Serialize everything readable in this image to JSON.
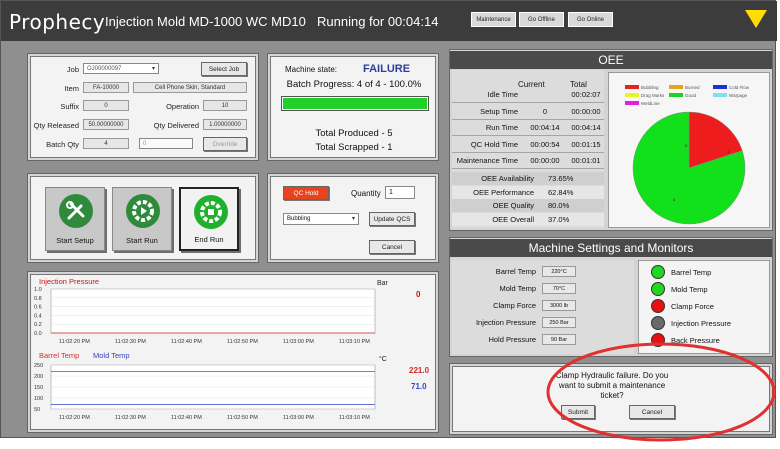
{
  "header": {
    "brand": "Prophecy",
    "machine_title": "Injection Mold MD-1000 WC MD10",
    "running": "Running for 00:04:14",
    "buttons": [
      "Maintenance",
      "Go Offline",
      "Go Online"
    ],
    "warning_icon": "warning-triangle-icon",
    "warning_color": "#ffdd00"
  },
  "job": {
    "job_label": "Job",
    "job_value": "OJ00000097",
    "select_job": "Select Job",
    "item_label": "Item",
    "item_value": "FA-10000",
    "item_desc": "Cell Phone Skin, Standard",
    "suffix_label": "Suffix",
    "suffix_value": "0",
    "operation_label": "Operation",
    "operation_value": "10",
    "qty_released_label": "Qty Released",
    "qty_released_value": "50.00000000",
    "qty_delivered_label": "Qty Delivered",
    "qty_delivered_value": "1.00000000",
    "batch_qty_label": "Batch Qty",
    "batch_qty_value": "4",
    "batch_input_value": "0",
    "override": "Override"
  },
  "machine_state": {
    "label": "Machine state:",
    "value": "FAILURE",
    "value_color": "#2c3e9c",
    "batch_progress": "Batch Progress: 4 of 4 - 100.0%",
    "progress": 1.0,
    "progress_color": "#22d02a",
    "total_produced": "Total Produced - 5",
    "total_scrapped": "Total Scrapped - 1"
  },
  "actions": {
    "start_setup": "Start Setup",
    "start_run": "Start Run",
    "end_run": "End Run"
  },
  "qc": {
    "qc_hold": "QC Hold",
    "qc_hold_color": "#e8431f",
    "quantity_label": "Quantity",
    "quantity_value": "1",
    "reason": "Bubbling",
    "update_qcs": "Update QCS",
    "cancel": "Cancel"
  },
  "chart_data": [
    {
      "type": "line",
      "title": "Injection Pressure",
      "unit": "Bar",
      "current": "0",
      "current_color": "#cc1111",
      "x": [
        "11:02:20 PM",
        "11:02:30 PM",
        "11:02:40 PM",
        "11:02:50 PM",
        "11:03:00 PM",
        "11:03:10 PM"
      ],
      "yticks": [
        "1.0",
        "0.8",
        "0.6",
        "0.4",
        "0.2",
        "0.0"
      ],
      "ylim": [
        0,
        1
      ],
      "series": [
        {
          "name": "Injection Pressure",
          "color": "#d62b2b",
          "values": [
            0,
            0,
            0,
            0,
            0,
            0
          ]
        }
      ]
    },
    {
      "type": "line",
      "unit": "°C",
      "x": [
        "11:02:20 PM",
        "11:02:30 PM",
        "11:02:40 PM",
        "11:02:50 PM",
        "11:03:00 PM",
        "11:03:10 PM"
      ],
      "yticks": [
        "250",
        "200",
        "150",
        "100",
        "50"
      ],
      "ylim": [
        50,
        250
      ],
      "series": [
        {
          "name": "Barrel Temp",
          "color": "#d62b2b",
          "current": "221.0",
          "values": [
            221,
            221,
            221,
            221,
            221,
            221
          ]
        },
        {
          "name": "Mold Temp",
          "color": "#3344c0",
          "current": "71.0",
          "values": [
            71,
            71,
            71,
            71,
            71,
            71
          ]
        }
      ]
    },
    {
      "type": "pie",
      "legend": [
        "Bubbling",
        "Burned",
        "Cold Flow",
        "Drag Marks",
        "Good",
        "Warpage",
        "WeldLine"
      ],
      "legend_colors": [
        "#e8231f",
        "#e8a31f",
        "#1f2fd8",
        "#f0f020",
        "#22d02a",
        "#80e0f0",
        "#e020e0"
      ],
      "slices": [
        {
          "label": "Bubbling",
          "value": 1,
          "color": "#ee1c1c"
        },
        {
          "label": "Good",
          "value": 4,
          "color": "#11e01a"
        }
      ],
      "slice_labels": [
        "0",
        "1",
        "4"
      ]
    }
  ],
  "oee": {
    "title": "OEE",
    "col_current": "Current",
    "col_total": "Total",
    "rows": [
      {
        "label": "Idle Time",
        "current": "",
        "total": "00:02:07"
      },
      {
        "label": "Setup Time",
        "current": "0",
        "total": "00:00:00"
      },
      {
        "label": "Run Time",
        "current": "00:04:14",
        "total": "00:04:14"
      },
      {
        "label": "QC Hold Time",
        "current": "00:00:54",
        "total": "00:01:15"
      },
      {
        "label": "Maintenance Time",
        "current": "00:00:00",
        "total": "00:01:01"
      }
    ],
    "metrics": [
      {
        "label": "OEE Availability",
        "value": "73.65%"
      },
      {
        "label": "OEE Performance",
        "value": "62.84%"
      },
      {
        "label": "OEE Quality",
        "value": "80.0%"
      },
      {
        "label": "OEE Overall",
        "value": "37.0%"
      }
    ]
  },
  "settings": {
    "title": "Machine Settings and Monitors",
    "rows": [
      {
        "label": "Barrel Temp",
        "value": "220°C"
      },
      {
        "label": "Mold Temp",
        "value": "70°C"
      },
      {
        "label": "Clamp Force",
        "value": "3000 lb"
      },
      {
        "label": "Injection Pressure",
        "value": "250 Bar"
      },
      {
        "label": "Hold Pressure",
        "value": "90 Bar"
      }
    ],
    "monitors": [
      {
        "label": "Barrel Temp",
        "color": "#1fd81f"
      },
      {
        "label": "Mold Temp",
        "color": "#1fd81f"
      },
      {
        "label": "Clamp Force",
        "color": "#e81010"
      },
      {
        "label": "Injection Pressure",
        "color": "#6a6a6a"
      },
      {
        "label": "Back Pressure",
        "color": "#e81010"
      }
    ]
  },
  "alert": {
    "message": "Clamp Hydraulic failure. Do you want to submit a maintenance ticket?",
    "submit": "Submit",
    "cancel": "Cancel",
    "highlight_color": "#e03030"
  }
}
